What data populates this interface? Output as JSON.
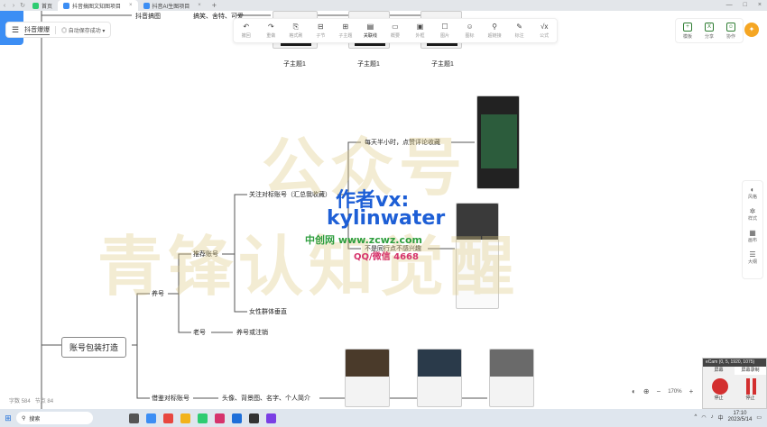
{
  "browser": {
    "tabs": [
      {
        "label": "首页",
        "color": "#2ecc71",
        "active": false
      },
      {
        "label": "抖音搞图文知图项目",
        "color": "#3c8ef4",
        "active": true
      },
      {
        "label": "抖音AI生图项目",
        "color": "#3c8ef4",
        "active": false
      }
    ],
    "new_tab": "+",
    "window_controls": [
      "—",
      "□",
      "×"
    ]
  },
  "app": {
    "title": "抖音爆爆",
    "save_status": "自动保存成功",
    "menu_icon": "hamburger-icon"
  },
  "toolbar": [
    {
      "icon": "↶",
      "label": "撤回",
      "name": "undo"
    },
    {
      "icon": "↷",
      "label": "重做",
      "name": "redo"
    },
    {
      "icon": "⎘",
      "label": "格式刷",
      "name": "format-painter"
    },
    {
      "icon": "⊟",
      "label": "子节",
      "name": "child-node"
    },
    {
      "icon": "⊞",
      "label": "子主题",
      "name": "subtopic"
    },
    {
      "icon": "▤",
      "label": "关联线",
      "name": "relation-line",
      "active": true
    },
    {
      "icon": "▭",
      "label": "概要",
      "name": "summary"
    },
    {
      "icon": "▣",
      "label": "外框",
      "name": "frame"
    },
    {
      "icon": "☐",
      "label": "图片",
      "name": "image"
    },
    {
      "icon": "☺",
      "label": "图标",
      "name": "icon"
    },
    {
      "icon": "⚲",
      "label": "超链接",
      "name": "hyperlink"
    },
    {
      "icon": "✎",
      "label": "标注",
      "name": "annotation"
    },
    {
      "icon": "√x",
      "label": "公式",
      "name": "formula"
    }
  ],
  "right_tools": [
    {
      "icon": "+",
      "label": "模板",
      "name": "template"
    },
    {
      "icon": "X",
      "label": "分享",
      "name": "share"
    },
    {
      "icon": "☺",
      "label": "协作",
      "name": "collaborate"
    }
  ],
  "side_panel": [
    {
      "icon": "◐",
      "label": "风格",
      "name": "style"
    },
    {
      "icon": "✲",
      "label": "样式",
      "name": "format"
    },
    {
      "icon": "▦",
      "label": "画布",
      "name": "canvas"
    },
    {
      "icon": "☰",
      "label": "大纲",
      "name": "outline"
    }
  ],
  "mindmap": {
    "root": "账号包装打造",
    "top_partial": "抖音搞图",
    "top_partial_sub": "搞笑、舍特、可爱",
    "subtopic_label": "子主题1",
    "yanghao": "养号",
    "tuijian": "推荐账号",
    "guanzhu": "关注对标账号（汇总我收藏）",
    "meitian": "每天半小时，点赞评论收藏",
    "butong": "不是同行点不感兴趣",
    "nvxing": "女性群体垂直",
    "laohao": "老号",
    "laohao_child": "养号或注销",
    "duibiao": "借鉴对标账号",
    "duibiao_child": "头像、背景图、名字、个人简介"
  },
  "watermark": {
    "line1": "公众号",
    "line2": "青锋认知觉醒",
    "author": "作者vx:",
    "author_id": "kylinwater",
    "site": "中创网 www.zcwz.com",
    "qq": "QQ/微信 4668"
  },
  "stats": {
    "words_label": "字数",
    "words": "584",
    "nodes_label": "节点",
    "nodes": "84"
  },
  "zoom": {
    "level": "170%",
    "minus": "−",
    "plus": "+"
  },
  "recorder": {
    "title": "eCam (0, 5, 1920, 1075)",
    "tab1": "屏幕",
    "tab2": "屏幕录制",
    "btn1": "停止",
    "btn2": "停止"
  },
  "taskbar": {
    "search_placeholder": "搜索",
    "time": "17:10",
    "date": "2023/5/14",
    "lang": "中"
  },
  "colors": {
    "accent": "#3c8ef4",
    "watermark": "#dcc882",
    "author_wm": "#1e5fd6",
    "site_wm": "#2e9e3e",
    "qq_wm": "#d6336c"
  }
}
